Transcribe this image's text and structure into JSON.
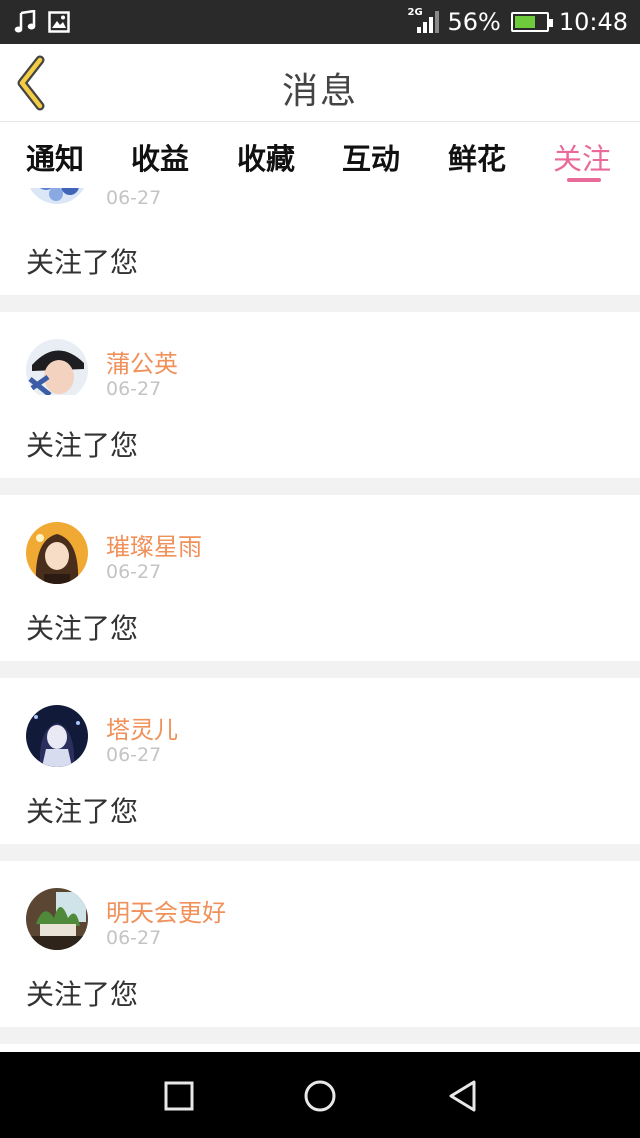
{
  "status_bar": {
    "network": "2G",
    "battery": "56%",
    "time": "10:48",
    "icons": [
      "music-icon",
      "image-icon",
      "signal-icon",
      "battery-icon"
    ]
  },
  "header": {
    "title": "消息",
    "back_icon": "chevron-left-icon",
    "accent": "#e96a99"
  },
  "tabs": [
    {
      "label": "通知",
      "active": false
    },
    {
      "label": "收益",
      "active": false
    },
    {
      "label": "收藏",
      "active": false
    },
    {
      "label": "互动",
      "active": false
    },
    {
      "label": "鲜花",
      "active": false
    },
    {
      "label": "关注",
      "active": true
    }
  ],
  "notifications": [
    {
      "username": "",
      "date": "06-27",
      "action": "关注了您"
    },
    {
      "username": "蒲公英",
      "date": "06-27",
      "action": "关注了您"
    },
    {
      "username": "璀璨星雨",
      "date": "06-27",
      "action": "关注了您"
    },
    {
      "username": "塔灵儿",
      "date": "06-27",
      "action": "关注了您"
    },
    {
      "username": "明天会更好",
      "date": "06-27",
      "action": "关注了您"
    }
  ],
  "nav_bar": {
    "icons": [
      "recent-apps-icon",
      "home-icon",
      "back-icon"
    ]
  }
}
